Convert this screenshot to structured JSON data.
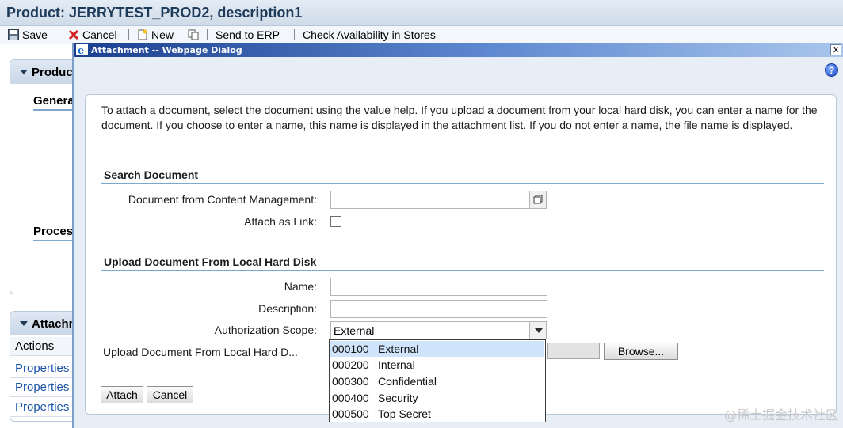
{
  "app": {
    "title": "Product: JERRYTEST_PROD2, description1",
    "toolbar": {
      "save": "Save",
      "cancel": "Cancel",
      "new": "New",
      "send_to_erp": "Send to ERP",
      "check_availability": "Check Availability in Stores"
    },
    "panels": {
      "product_header": "Product",
      "general_label": "Genera",
      "process_label": "Proces",
      "attachments_header": "Attachm",
      "actions_label": "Actions",
      "properties": [
        "Properties",
        "Properties",
        "Properties"
      ]
    }
  },
  "dialog": {
    "title": "Attachment -- Webpage Dialog",
    "close_glyph": "x",
    "help_glyph": "?",
    "intro_text": "To attach a document, select the document using the value help. If you upload a document from your local hard disk, you can enter a name for the document. If you choose to enter a name, this name is displayed in the attachment list. If you do not enter a name, the file name is displayed.",
    "search_section": {
      "title": "Search Document",
      "document_label": "Document from Content Management:",
      "document_value": "",
      "attach_link_label": "Attach as Link:",
      "attach_link_checked": false
    },
    "upload_section": {
      "title": "Upload Document From Local Hard Disk",
      "name_label": "Name:",
      "name_value": "",
      "description_label": "Description:",
      "description_value": "",
      "scope_label": "Authorization Scope:",
      "scope_value": "External",
      "upload_label": "Upload Document From Local Hard D...",
      "browse_button": "Browse..."
    },
    "scope_options": [
      {
        "code": "000100",
        "text": "External",
        "selected": true
      },
      {
        "code": "000200",
        "text": "Internal",
        "selected": false
      },
      {
        "code": "000300",
        "text": "Confidential",
        "selected": false
      },
      {
        "code": "000400",
        "text": "Security",
        "selected": false
      },
      {
        "code": "000500",
        "text": "Top Secret",
        "selected": false
      }
    ],
    "attach_button": "Attach",
    "cancel_button": "Cancel"
  },
  "watermark": "@稀土掘金技术社区",
  "colors": {
    "title_bar_start": "#1a3f8f",
    "section_underline": "#7fa6cc",
    "link": "#1a55a8",
    "selected_option": "#cfe4fb"
  }
}
